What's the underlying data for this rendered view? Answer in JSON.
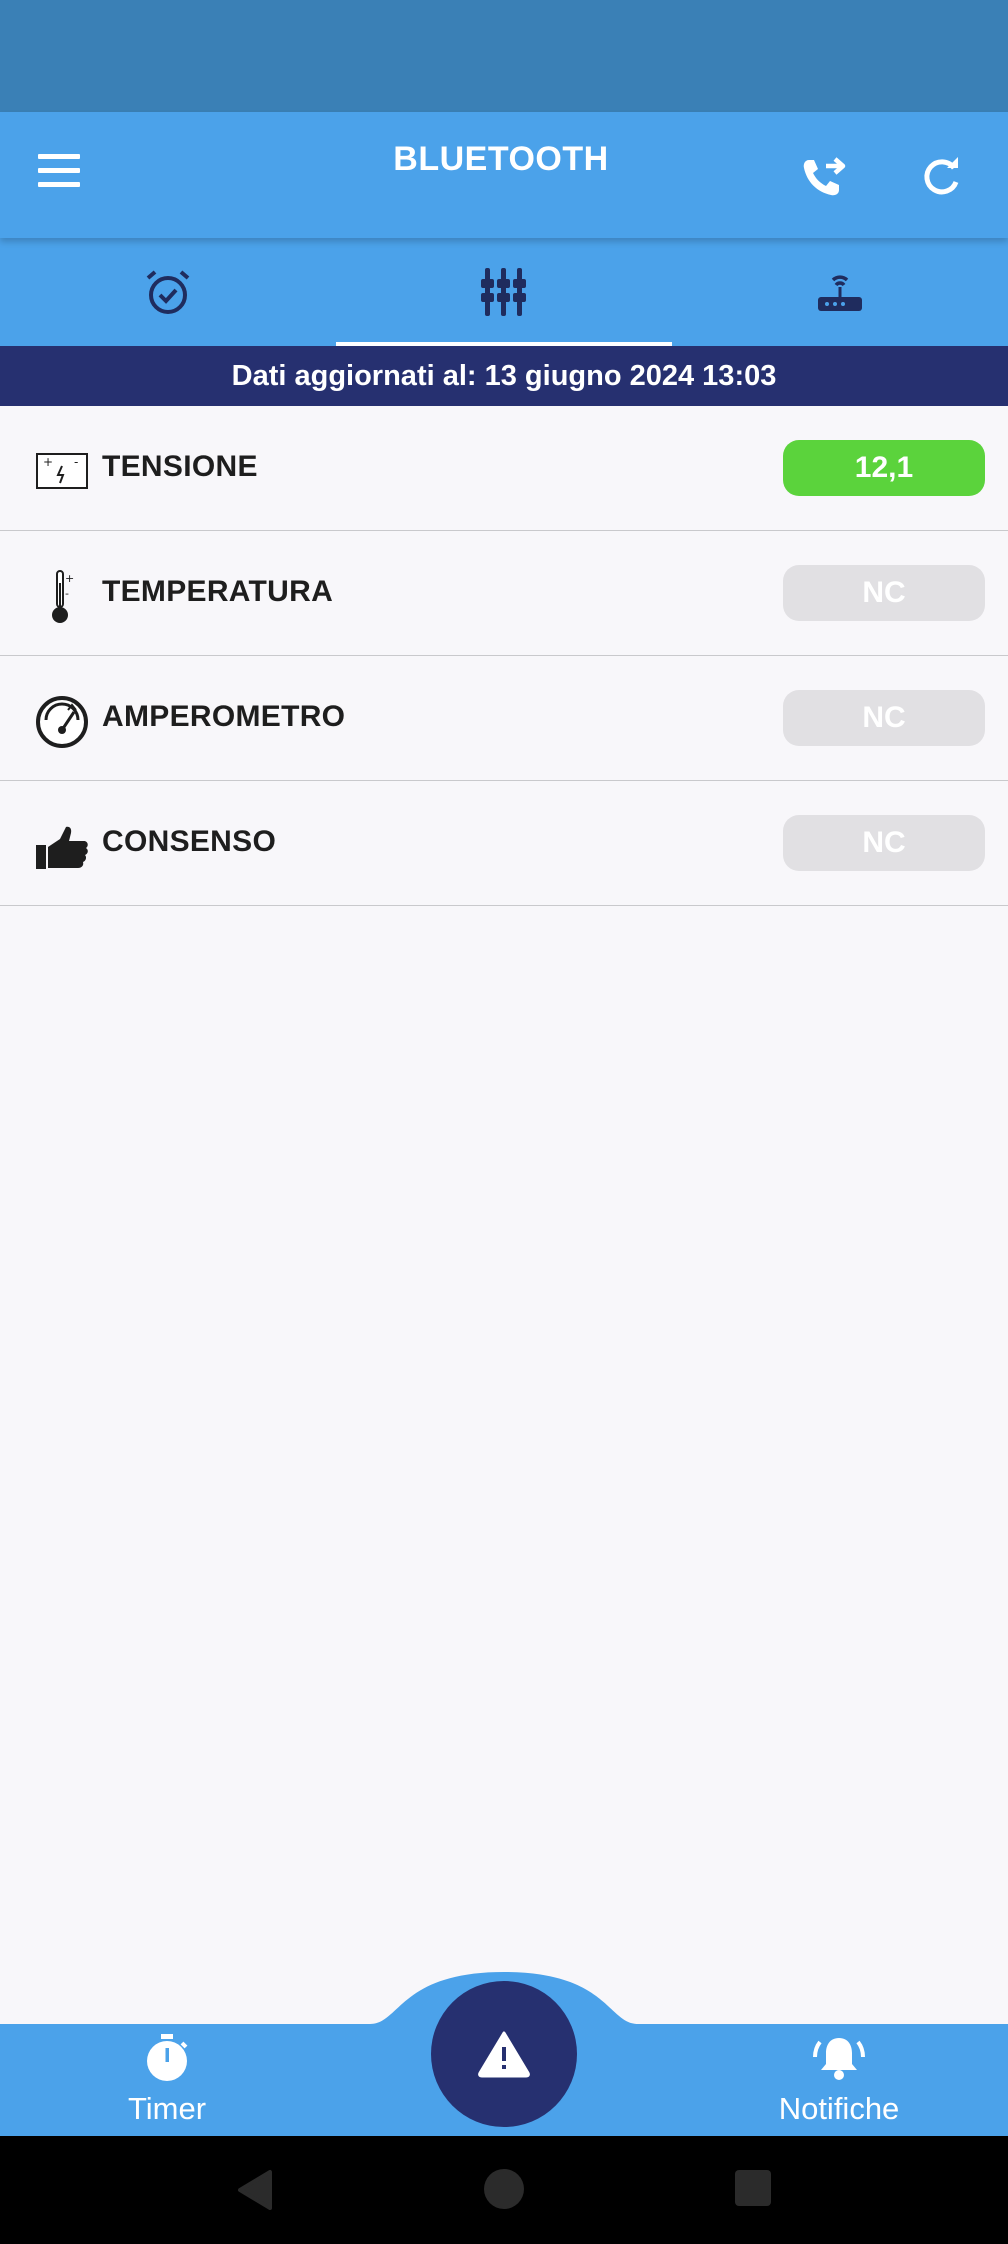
{
  "app_bar": {
    "title": "BLUETOOTH",
    "menu_icon": "hamburger-menu-icon",
    "call_icon": "phone-forward-icon",
    "refresh_icon": "refresh-icon"
  },
  "tabs": [
    {
      "icon": "alarm-check-icon",
      "selected": false
    },
    {
      "icon": "connector-pins-icon",
      "selected": true
    },
    {
      "icon": "router-wifi-icon",
      "selected": false
    }
  ],
  "update_banner": "Dati aggiornati al: 13 giugno 2024 13:03",
  "rows": [
    {
      "icon": "battery-voltage-icon",
      "label": "TENSIONE",
      "value": "12,1",
      "status": "ok"
    },
    {
      "icon": "thermometer-icon",
      "label": "TEMPERATURA",
      "value": "NC",
      "status": "nc"
    },
    {
      "icon": "gauge-icon",
      "label": "AMPEROMETRO",
      "value": "NC",
      "status": "nc"
    },
    {
      "icon": "thumbs-up-icon",
      "label": "CONSENSO",
      "value": "NC",
      "status": "nc"
    }
  ],
  "bottom_nav": {
    "timer_label": "Timer",
    "notifiche_label": "Notifiche",
    "fab_icon": "warning-icon"
  },
  "colors": {
    "app_bar": "#4ba2ea",
    "status_bar": "#3a80b6",
    "banner": "#263070",
    "value_ok": "#5bd33c",
    "value_nc": "#e1e0e3"
  }
}
